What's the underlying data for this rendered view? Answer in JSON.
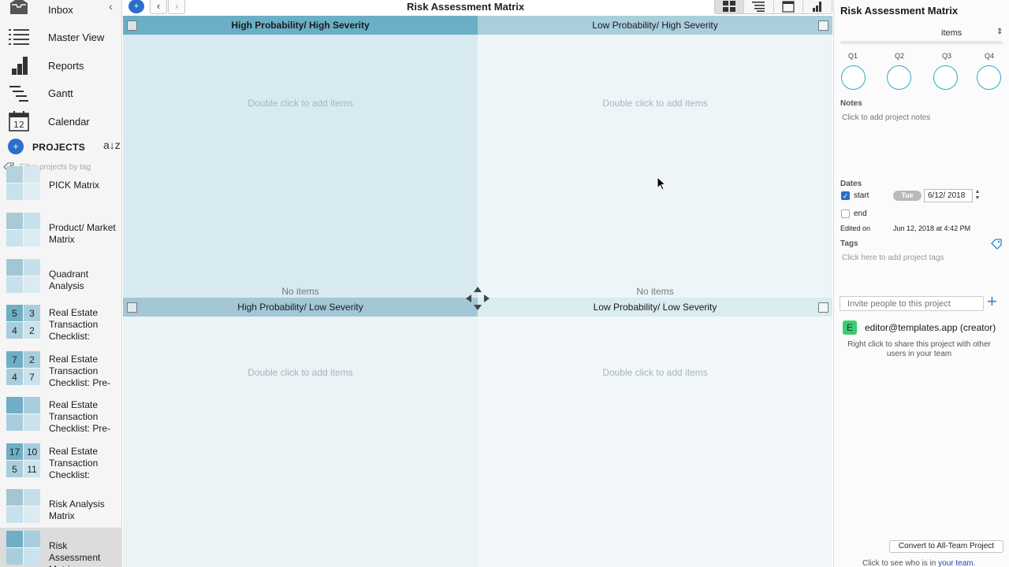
{
  "window": {
    "title": "Risk Assessment Matrix"
  },
  "sidebar": {
    "collapse_icon": "chevron-left",
    "nav": [
      {
        "label": "Inbox",
        "icon": "inbox-icon"
      },
      {
        "label": "Master View",
        "icon": "list-icon"
      },
      {
        "label": "Reports",
        "icon": "bar-chart-icon"
      },
      {
        "label": "Gantt",
        "icon": "gantt-icon"
      },
      {
        "label": "Calendar",
        "icon": "calendar-icon",
        "icon_text": "12"
      }
    ],
    "projects_title": "PROJECTS",
    "sort_label": "a↓z",
    "filter_placeholder": "Filter projects by tag",
    "projects": [
      {
        "name": "PICK Matrix",
        "counts": [
          "",
          "",
          "",
          ""
        ]
      },
      {
        "name": "Product/ Market Matrix",
        "counts": [
          "",
          "",
          "",
          ""
        ]
      },
      {
        "name": "Quadrant Analysis",
        "counts": [
          "",
          "",
          "",
          ""
        ]
      },
      {
        "name": "Real Estate Transaction Checklist:",
        "counts": [
          "5",
          "3",
          "4",
          "2"
        ]
      },
      {
        "name": "Real Estate Transaction Checklist: Pre-",
        "counts": [
          "7",
          "2",
          "4",
          "7"
        ]
      },
      {
        "name": "Real Estate Transaction Checklist: Pre-",
        "counts": [
          "",
          "",
          "",
          ""
        ]
      },
      {
        "name": "Real Estate Transaction Checklist:",
        "counts": [
          "17",
          "10",
          "5",
          "11"
        ]
      },
      {
        "name": "Risk Analysis Matrix",
        "counts": [
          "",
          "",
          "",
          ""
        ]
      },
      {
        "name": "Risk Assessment Matrix",
        "counts": [
          "",
          "",
          "",
          ""
        ],
        "selected": true
      }
    ]
  },
  "toolbar": {
    "title": "Risk Assessment Matrix",
    "views": [
      "grid-view-icon",
      "list-view-icon",
      "calendar-view-icon",
      "report-view-icon"
    ],
    "active_view": 0
  },
  "matrix": {
    "quadrants": [
      {
        "title": "High Probability/ High Severity",
        "hint": "Double click to add items",
        "empty": "No items",
        "bold": true
      },
      {
        "title": "Low Probability/ High Severity",
        "hint": "Double click to add items",
        "empty": "No items",
        "bold": false
      },
      {
        "title": "High Probability/ Low Severity",
        "hint": "Double click to add items",
        "empty": "",
        "bold": false
      },
      {
        "title": "Low Probability/ Low Severity",
        "hint": "Double click to add items",
        "empty": "",
        "bold": false
      }
    ],
    "colors": {
      "q1_head": "#6aafc5",
      "q1_body": "#d7eaf2",
      "q2_head": "#a9cfdc",
      "q2_body": "#eef5f8",
      "q3_head": "#a3c7d5",
      "q3_body": "#ebf3f6",
      "q4_head": "#d9ecef",
      "q4_body": "#f2f7f9"
    }
  },
  "panel": {
    "title": "Risk Assessment Matrix",
    "items_select": "items",
    "quarters": [
      "Q1",
      "Q2",
      "Q3",
      "Q4"
    ],
    "notes_title": "Notes",
    "notes_hint": "Click to add project notes",
    "dates_title": "Dates",
    "start_label": "start",
    "start_checked": true,
    "start_day": "Tue",
    "start_date": "6/12/ 2018",
    "end_label": "end",
    "end_checked": false,
    "edited_label": "Edited on",
    "edited_value": "Jun 12, 2018 at 4:42 PM",
    "tags_title": "Tags",
    "tags_hint": "Click here to add project tags",
    "invite_placeholder": "Invite people to this project",
    "user_initial": "E",
    "user_email": "editor@templates.app (creator)",
    "share_hint": "Right click to share this project with other users in your team",
    "convert_label": "Convert to All-Team Project",
    "team_hint_prefix": "Click to see who is in ",
    "team_hint_link": "your team."
  }
}
